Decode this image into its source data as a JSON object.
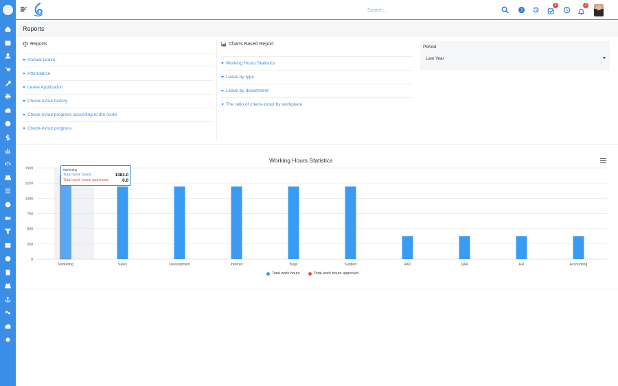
{
  "app": {
    "search_placeholder": "Search...",
    "badges": {
      "approvals": "3",
      "notifications": "1"
    },
    "colors": {
      "accent": "#3a8ee6",
      "danger": "#e8542f"
    }
  },
  "sidebar": {
    "icons": [
      "home-icon",
      "calendar-icon",
      "user-icon",
      "cart-icon",
      "key-icon",
      "snowflake-icon",
      "factory-icon",
      "globe-icon",
      "dollar-icon",
      "bar-chart-icon",
      "balance-scale-icon",
      "team-icon",
      "list-icon",
      "help-icon",
      "video-icon",
      "filter-icon",
      "calendar-days-icon",
      "user-circle-icon",
      "id-card-icon",
      "users-icon",
      "anchor-icon",
      "cogs-icon",
      "industry-icon",
      "settings-icon"
    ]
  },
  "page": {
    "title": "Reports"
  },
  "reports": {
    "title": "Reports",
    "items": [
      "Annual Leave",
      "Attendance",
      "Leave Application",
      "Check-in/out history",
      "Check-in/out progress according to the route",
      "Check-in/out progress"
    ]
  },
  "charts_report": {
    "title": "Charts Based Report",
    "items": [
      "Working Hours Statistics",
      "Leave by type",
      "Leave by department",
      "The ratio of check-in/out by workplace"
    ]
  },
  "period": {
    "label": "Period",
    "selected": "Last Year"
  },
  "chart_data": {
    "type": "bar",
    "title": "Working Hours Statistics",
    "xlabel": "",
    "ylabel": "",
    "ylim": [
      0,
      1500
    ],
    "yticks": [
      "0",
      "250",
      "500",
      "750",
      "1000",
      "1250",
      "1500"
    ],
    "categories": [
      "Marketing",
      "Sales",
      "Development",
      "Internet",
      "Bugs",
      "Support",
      "R&D",
      "Q&A",
      "HR",
      "Accounting"
    ],
    "series": [
      {
        "name": "Total work hours",
        "color": "#3a9bf2",
        "values": [
          1383,
          1195,
          1195,
          1195,
          1195,
          1195,
          380,
          380,
          380,
          380
        ]
      },
      {
        "name": "Total work hours approved",
        "color": "#e8542f",
        "values": [
          0,
          0,
          0,
          0,
          0,
          0,
          0,
          0,
          0,
          0
        ]
      }
    ],
    "grid": true,
    "legend": "bottom-center",
    "tooltip": {
      "category": "Marketing",
      "rows": [
        {
          "label": "Total work hours",
          "value": "1383.0"
        },
        {
          "label": "Total work hours approved",
          "value": "0.0"
        }
      ]
    }
  }
}
